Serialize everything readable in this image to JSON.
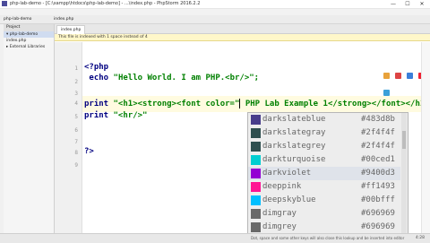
{
  "window": {
    "title": "php-lab-demo - [C:\\xampp\\htdocs\\php-lab-demo] - ...\\index.php - PhpStorm 2016.2.2",
    "controls": [
      "—",
      "☐",
      "✕"
    ]
  },
  "menu": [
    "File",
    "Edit",
    "View",
    "Navigate",
    "Code",
    "Refactor",
    "Run",
    "Tools",
    "VCS",
    "Window",
    "Help"
  ],
  "toolbar": {
    "crumb_project": "php-lab-demo",
    "crumb_file": "index.php"
  },
  "project": {
    "tab": "Project",
    "items": [
      {
        "label": "▾ php-lab-demo",
        "selected": true
      },
      {
        "label": "  index.php",
        "selected": false
      },
      {
        "label": "▸ External Libraries",
        "selected": false
      }
    ]
  },
  "editor": {
    "tab": "index.php",
    "notice": "This file is indexed with 1 space instead of 4",
    "line_numbers": [
      "1",
      "2",
      "3",
      "4",
      "5",
      "6",
      "7",
      "8",
      "9"
    ],
    "lines": {
      "l1": "<?php",
      "l2_kw": "echo",
      "l2_str": "\"Hello World. I am PHP.<br/>\";",
      "l4_kw": "print",
      "l4_str": "\"<h1><strong><font color=\"",
      "l4_rest": " PHP Lab Example 1</strong></font></h1>\";",
      "l5_kw": "print",
      "l5_str": "\"<hr/>\"",
      "l8": "?>"
    }
  },
  "autocomplete": {
    "items": [
      {
        "name": "darkslateblue",
        "hex": "#483d8b",
        "color": "#483d8b"
      },
      {
        "name": "darkslategray",
        "hex": "#2f4f4f",
        "color": "#2f4f4f"
      },
      {
        "name": "darkslategrey",
        "hex": "#2f4f4f",
        "color": "#2f4f4f"
      },
      {
        "name": "darkturquoise",
        "hex": "#00ced1",
        "color": "#00ced1"
      },
      {
        "name": "darkviolet",
        "hex": "#9400d3",
        "color": "#9400d3"
      },
      {
        "name": "deeppink",
        "hex": "#ff1493",
        "color": "#ff1493"
      },
      {
        "name": "deepskyblue",
        "hex": "#00bfff",
        "color": "#00bfff"
      },
      {
        "name": "dimgray",
        "hex": "#696969",
        "color": "#696969"
      },
      {
        "name": "dimgrey",
        "hex": "#696969",
        "color": "#696969"
      },
      {
        "name": "dodgerblue",
        "hex": "#1e90ff",
        "color": "#1e90ff"
      }
    ]
  },
  "status": {
    "hint": "Dot, space and some other keys will also close this lookup and be inserted into editor",
    "position": "4:28"
  },
  "colors": {
    "accent": "#000080",
    "string": "#008000",
    "current_line": "#fffbe0"
  }
}
